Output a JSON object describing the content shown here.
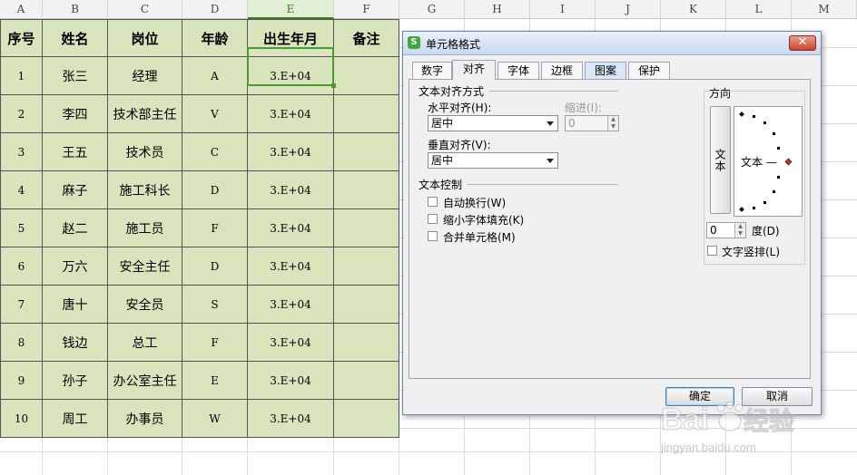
{
  "sheet": {
    "columns": [
      "A",
      "B",
      "C",
      "D",
      "E",
      "F",
      "G",
      "H",
      "I",
      "J",
      "K",
      "L",
      "M"
    ],
    "active_column": "E",
    "headers": [
      "序号",
      "姓名",
      "岗位",
      "年龄",
      "出生年月",
      "备注"
    ],
    "rows": [
      [
        "1",
        "张三",
        "经理",
        "A",
        "3.E+04",
        ""
      ],
      [
        "2",
        "李四",
        "技术部主任",
        "V",
        "3.E+04",
        ""
      ],
      [
        "3",
        "王五",
        "技术员",
        "C",
        "3.E+04",
        ""
      ],
      [
        "4",
        "麻子",
        "施工科长",
        "D",
        "3.E+04",
        ""
      ],
      [
        "5",
        "赵二",
        "施工员",
        "F",
        "3.E+04",
        ""
      ],
      [
        "6",
        "万六",
        "安全主任",
        "D",
        "3.E+04",
        ""
      ],
      [
        "7",
        "唐十",
        "安全员",
        "S",
        "3.E+04",
        ""
      ],
      [
        "8",
        "钱边",
        "总工",
        "F",
        "3.E+04",
        ""
      ],
      [
        "9",
        "孙子",
        "办公室主任",
        "E",
        "3.E+04",
        ""
      ],
      [
        "10",
        "周工",
        "办事员",
        "W",
        "3.E+04",
        ""
      ]
    ],
    "fill_color": "#d8e4bc",
    "selection_color": "#4e9a31"
  },
  "dialog": {
    "logo": "S",
    "title": "单元格格式",
    "close": "✕",
    "tabs": [
      "数字",
      "对齐",
      "字体",
      "边框",
      "图案",
      "保护"
    ],
    "active_tab": "对齐",
    "text_align_group": "文本对齐方式",
    "horizontal_label": "水平对齐(H):",
    "horizontal_value": "居中",
    "indent_label": "缩进(I):",
    "indent_value": "0",
    "vertical_label": "垂直对齐(V):",
    "vertical_value": "居中",
    "text_control_group": "文本控制",
    "checkboxes": [
      "自动换行(W)",
      "缩小字体填充(K)",
      "合并单元格(M)"
    ],
    "orientation_group": "方向",
    "vertical_text_button": "文本",
    "dial_text": "文本 —",
    "degree_value": "0",
    "degree_label": "度(D)",
    "vertical_text_checkbox": "文字竖排(L)",
    "ok": "确定",
    "cancel": "取消"
  },
  "watermark": {
    "brand": "Baidu",
    "brand_cn": "经验",
    "url": "jingyan.baidu.com"
  }
}
